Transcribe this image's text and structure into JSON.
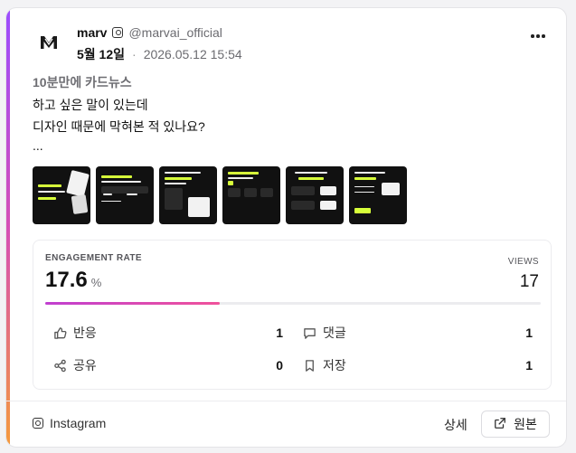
{
  "account": {
    "name": "marv",
    "handle": "@marvai_official",
    "date": "5월 12일",
    "separator": "·",
    "datetime": "2026.05.12 15:54"
  },
  "post": {
    "title": "10분만에 카드뉴스",
    "lines": [
      "하고 싶은 말이 있는데",
      "디자인 때문에 막혀본 적 있나요?",
      "..."
    ]
  },
  "thumbnails_count": 6,
  "stats": {
    "engagement_label": "ENGAGEMENT RATE",
    "engagement_value": "17.6",
    "engagement_unit": "%",
    "engagement_fraction": 0.353,
    "views_label": "VIEWS",
    "views_value": "17"
  },
  "metrics": {
    "reactions": {
      "label": "반응",
      "value": "1"
    },
    "comments": {
      "label": "댓글",
      "value": "1"
    },
    "shares": {
      "label": "공유",
      "value": "0"
    },
    "saves": {
      "label": "저장",
      "value": "1"
    }
  },
  "footer": {
    "platform": "Instagram",
    "detail_label": "상세",
    "original_label": "원본"
  },
  "colors": {
    "accent_top": "#9b4dff",
    "accent_mid": "#d64fb6",
    "accent_bottom": "#f59a3c",
    "thumb_highlight": "#d7ff3a"
  }
}
